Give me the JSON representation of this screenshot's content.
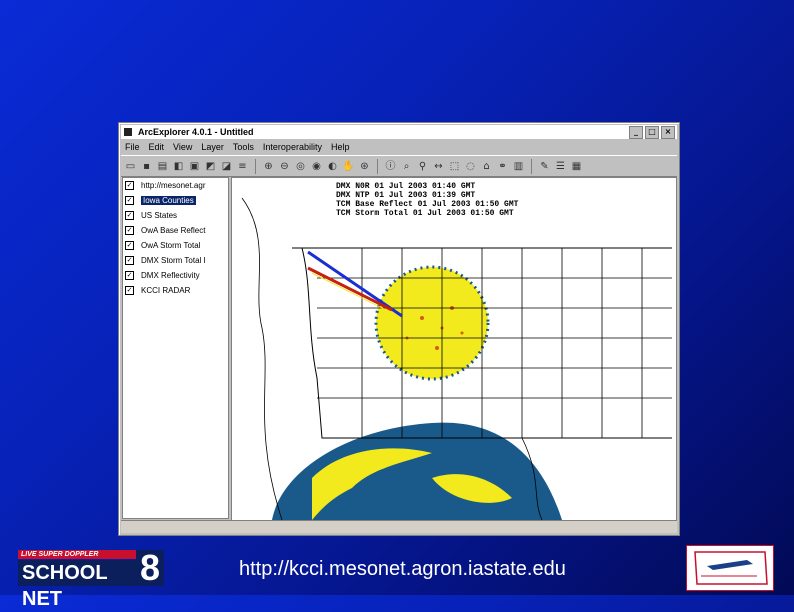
{
  "window": {
    "title": "ArcExplorer 4.0.1 - Untitled",
    "controls": [
      "_",
      "□",
      "×"
    ]
  },
  "menu": [
    "File",
    "Edit",
    "View",
    "Layer",
    "Tools",
    "Interoperability",
    "Help"
  ],
  "legend": {
    "items": [
      {
        "label": "http://mesonet.agr",
        "checked": true
      },
      {
        "label": "Iowa Counties",
        "checked": true,
        "selected": true
      },
      {
        "label": "US States",
        "checked": true
      },
      {
        "label": "OwA Base Reflect",
        "checked": true
      },
      {
        "label": "OwA Storm Total",
        "checked": true
      },
      {
        "label": "DMX Storm Total I",
        "checked": true
      },
      {
        "label": "DMX Reflectivity",
        "checked": true
      },
      {
        "label": "KCCI RADAR",
        "checked": true
      }
    ]
  },
  "map": {
    "header_lines": [
      "DMX N0R 01 Jul 2003 01:40 GMT",
      "DMX NTP 01 Jul 2003 01:39 GMT",
      "TCM Base Reflect 01 Jul 2003 01:50 GMT",
      "TCM Storm Total 01 Jul 2003 01:50 GMT"
    ],
    "colors": {
      "radar_yellow": "#f2ea1c",
      "radar_blue": "#1a5a8a",
      "track_blue": "#1a2fd0",
      "track_red": "#c82010"
    }
  },
  "footer": {
    "logo_top": "LIVE SUPER DOPPLER",
    "logo_main": "SCHOOL NET",
    "logo_number": "8",
    "url": "http://kcci.mesonet.agron.iastate.edu"
  }
}
